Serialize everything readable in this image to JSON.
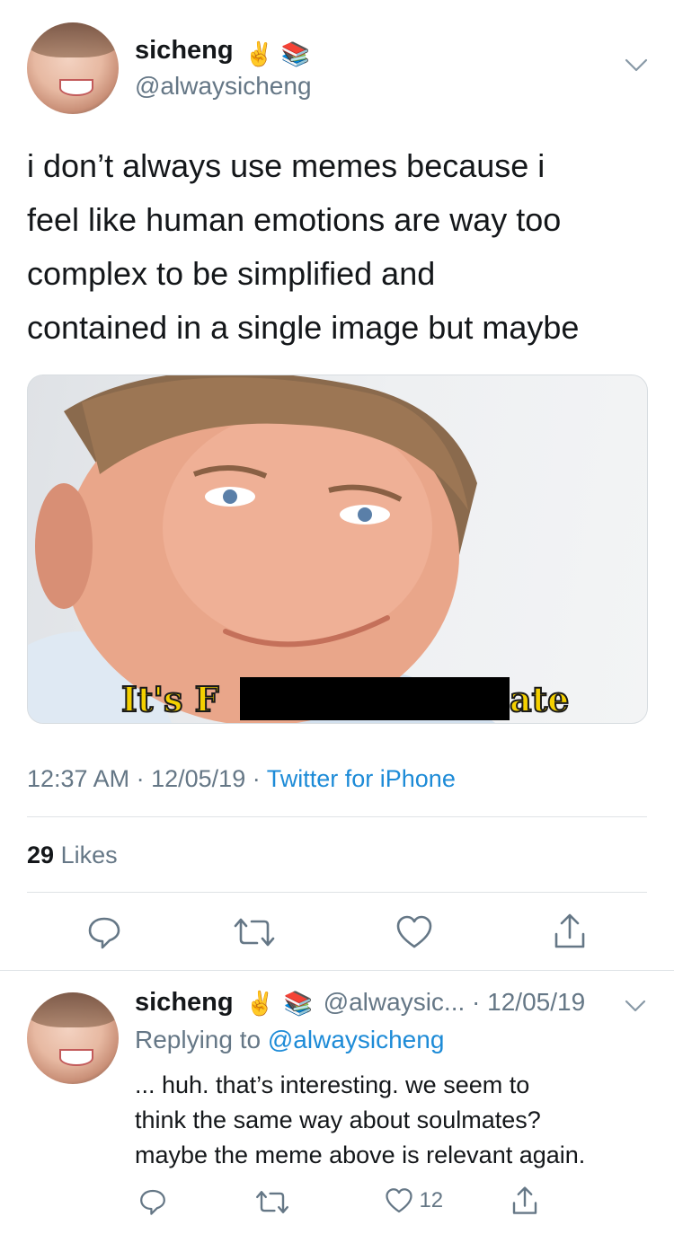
{
  "tweet": {
    "display_name": "sicheng",
    "name_emojis": [
      "✌️",
      "📚"
    ],
    "handle": "@alwaysicheng",
    "text_lines": [
      "i don’t always use memes because i",
      "feel like human emotions are way too",
      "complex to be simplified and",
      "contained in a single image but maybe"
    ],
    "image_caption_left": "It's F",
    "image_caption_right": "ate",
    "time": "12:37 AM",
    "date": "12/05/19",
    "separator": "·",
    "source": "Twitter for iPhone",
    "likes_count": "29",
    "likes_label": "Likes"
  },
  "reply": {
    "display_name": "sicheng",
    "name_emojis": [
      "✌️",
      "📚"
    ],
    "handle": "@alwaysic...",
    "date_sep": "·",
    "date": "12/05/19",
    "replying_to_label": "Replying to",
    "replying_to_handle": "@alwaysicheng",
    "text_lines": [
      "... huh. that’s interesting. we seem to",
      "think the same way about soulmates?",
      "maybe the meme above is relevant again."
    ],
    "like_count": "12"
  },
  "colors": {
    "link": "#1d8bd7",
    "secondary_text": "#657786",
    "primary_text": "#14171a",
    "divider": "#dfe3e6"
  },
  "icons": {
    "caret": "chevron-down-icon",
    "reply": "reply-icon",
    "retweet": "retweet-icon",
    "like": "heart-icon",
    "share": "share-icon"
  }
}
